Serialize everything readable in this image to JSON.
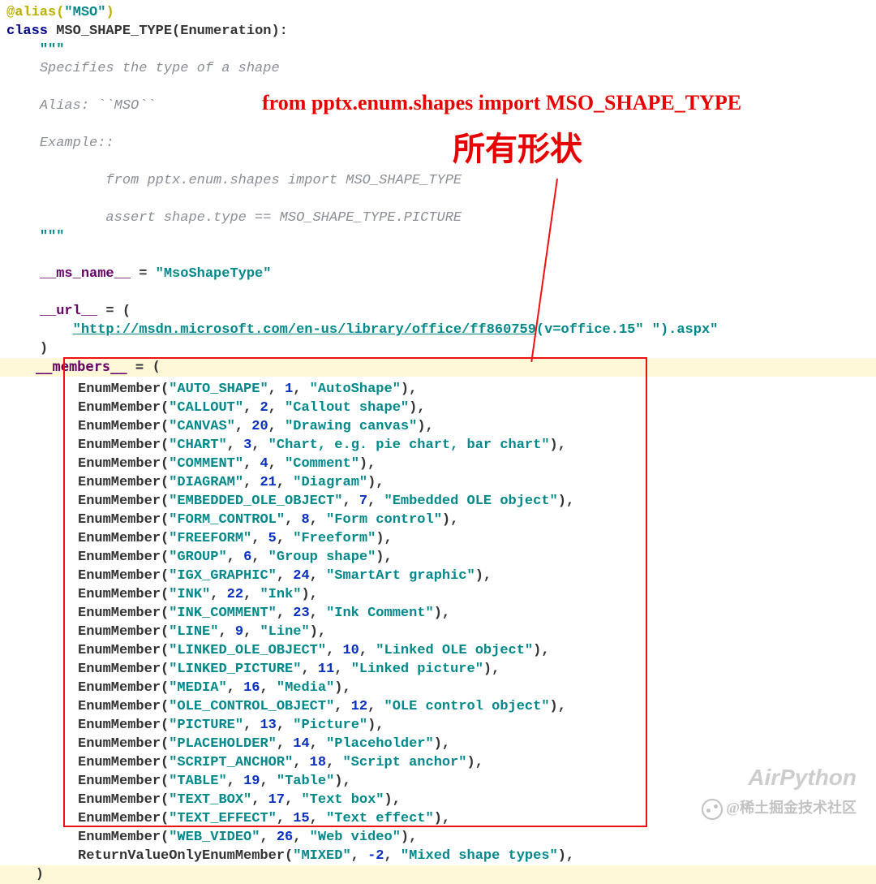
{
  "annotations": {
    "import_line": "from pptx.enum.shapes import  MSO_SHAPE_TYPE",
    "all_shapes_label": "所有形状"
  },
  "watermarks": {
    "brand": "AirPython",
    "footer": "@稀土掘金技术社区"
  },
  "code": {
    "decorator_prefix": "@alias(",
    "decorator_arg": "\"MSO\"",
    "decorator_suffix": ")",
    "class_kw": "class",
    "class_name": "MSO_SHAPE_TYPE",
    "class_base": "(Enumeration):",
    "doc_open": "\"\"\"",
    "doc_l1": "Specifies the type of a shape",
    "doc_l2": "Alias: ``MSO``",
    "doc_l3": "Example::",
    "doc_l4": "    from pptx.enum.shapes import MSO_SHAPE_TYPE",
    "doc_l5": "    assert shape.type == MSO_SHAPE_TYPE.PICTURE",
    "doc_close": "\"\"\"",
    "ms_name_attr": "__ms_name__",
    "ms_name_val": "\"MsoShapeType\"",
    "url_attr": "__url__",
    "url_text": "\"http://msdn.microsoft.com/en-us/library/office/ff860759",
    "url_tail": "(v=office.15\" \").aspx\"",
    "members_attr": "__members__",
    "eq": " = ",
    "paren_open": "(",
    "paren_close": ")",
    "enum_fn": "EnumMember",
    "return_fn": "ReturnValueOnlyEnumMember"
  },
  "members": [
    {
      "name": "\"AUTO_SHAPE\"",
      "val": "1",
      "desc": "\"AutoShape\""
    },
    {
      "name": "\"CALLOUT\"",
      "val": "2",
      "desc": "\"Callout shape\""
    },
    {
      "name": "\"CANVAS\"",
      "val": "20",
      "desc": "\"Drawing canvas\""
    },
    {
      "name": "\"CHART\"",
      "val": "3",
      "desc": "\"Chart, e.g. pie chart, bar chart\""
    },
    {
      "name": "\"COMMENT\"",
      "val": "4",
      "desc": "\"Comment\""
    },
    {
      "name": "\"DIAGRAM\"",
      "val": "21",
      "desc": "\"Diagram\""
    },
    {
      "name": "\"EMBEDDED_OLE_OBJECT\"",
      "val": "7",
      "desc": "\"Embedded OLE object\""
    },
    {
      "name": "\"FORM_CONTROL\"",
      "val": "8",
      "desc": "\"Form control\""
    },
    {
      "name": "\"FREEFORM\"",
      "val": "5",
      "desc": "\"Freeform\""
    },
    {
      "name": "\"GROUP\"",
      "val": "6",
      "desc": "\"Group shape\""
    },
    {
      "name": "\"IGX_GRAPHIC\"",
      "val": "24",
      "desc": "\"SmartArt graphic\""
    },
    {
      "name": "\"INK\"",
      "val": "22",
      "desc": "\"Ink\""
    },
    {
      "name": "\"INK_COMMENT\"",
      "val": "23",
      "desc": "\"Ink Comment\""
    },
    {
      "name": "\"LINE\"",
      "val": "9",
      "desc": "\"Line\""
    },
    {
      "name": "\"LINKED_OLE_OBJECT\"",
      "val": "10",
      "desc": "\"Linked OLE object\""
    },
    {
      "name": "\"LINKED_PICTURE\"",
      "val": "11",
      "desc": "\"Linked picture\""
    },
    {
      "name": "\"MEDIA\"",
      "val": "16",
      "desc": "\"Media\""
    },
    {
      "name": "\"OLE_CONTROL_OBJECT\"",
      "val": "12",
      "desc": "\"OLE control object\""
    },
    {
      "name": "\"PICTURE\"",
      "val": "13",
      "desc": "\"Picture\""
    },
    {
      "name": "\"PLACEHOLDER\"",
      "val": "14",
      "desc": "\"Placeholder\""
    },
    {
      "name": "\"SCRIPT_ANCHOR\"",
      "val": "18",
      "desc": "\"Script anchor\""
    },
    {
      "name": "\"TABLE\"",
      "val": "19",
      "desc": "\"Table\""
    },
    {
      "name": "\"TEXT_BOX\"",
      "val": "17",
      "desc": "\"Text box\""
    },
    {
      "name": "\"TEXT_EFFECT\"",
      "val": "15",
      "desc": "\"Text effect\""
    },
    {
      "name": "\"WEB_VIDEO\"",
      "val": "26",
      "desc": "\"Web video\""
    }
  ],
  "mixed": {
    "name": "\"MIXED\"",
    "val": "-2",
    "desc": "\"Mixed shape types\""
  }
}
